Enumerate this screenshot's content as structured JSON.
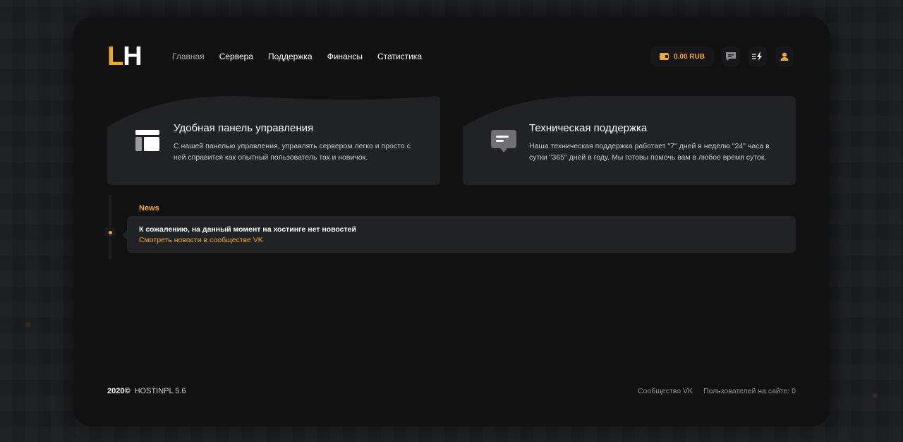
{
  "brand": {
    "logo_l": "L",
    "logo_h": "H",
    "accent_color": "#f0a829"
  },
  "nav": {
    "items": [
      {
        "label": "Главная",
        "active": true
      },
      {
        "label": "Сервера"
      },
      {
        "label": "Поддержка"
      },
      {
        "label": "Финансы"
      },
      {
        "label": "Статистика"
      }
    ]
  },
  "header": {
    "balance": "0.00 RUB",
    "icons": [
      "wallet-icon",
      "chat-icon",
      "lightning-icon",
      "user-icon"
    ]
  },
  "cards": [
    {
      "icon": "panel-icon",
      "title": "Удобная панель управления",
      "text": "С нашей панелью управления, управлять сервером легко и просто с ней справится как опытный пользователь так и новичок."
    },
    {
      "icon": "chat-bubble-icon",
      "title": "Техническая поддержка",
      "text": "Наша техническая поддержка работает \"7\" дней в неделю \"24\" часа в сутки \"365\" дней в году. Мы готовы помочь вам в любое время суток."
    }
  ],
  "news": {
    "title": "News",
    "message": "К сожалению, на данный момент на хостинге нет новостей",
    "link": "Смотреть новости в сообществе VK"
  },
  "footer": {
    "copyright": "2020©",
    "version": "HOSTINPL 5.6",
    "community_link": "Сообщество VK",
    "users_online": "Пользователей на сайте: 0"
  }
}
